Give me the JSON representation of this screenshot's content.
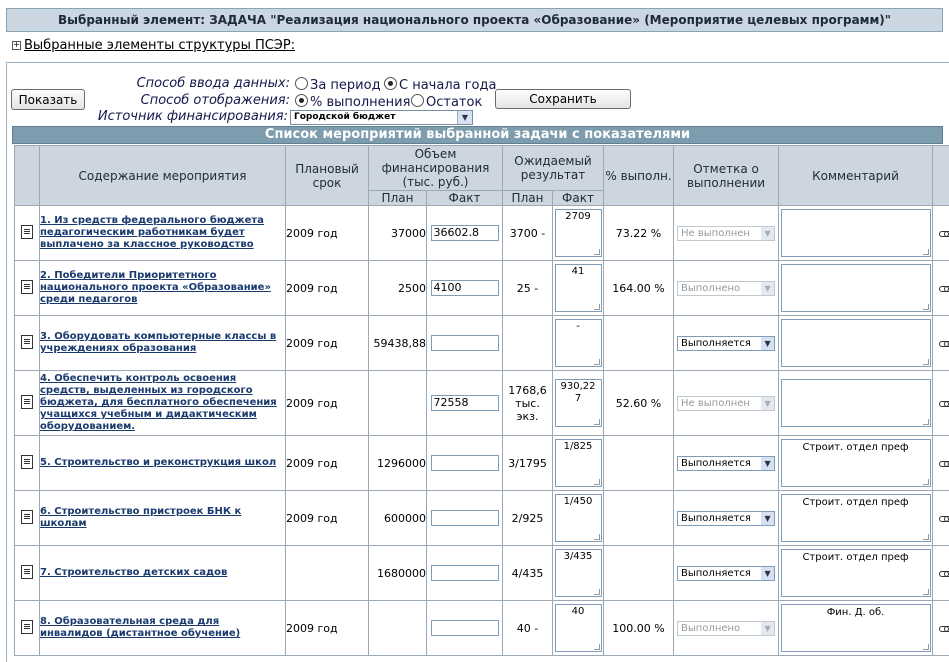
{
  "title": "Выбранный элемент: ЗАДАЧА \"Реализация национального проекта «Образование» (Мероприятие целевых программ)\"",
  "structure_toggle": "+",
  "structure_link": "Выбранные элементы структуры ПСЭР:",
  "controls": {
    "input_mode_label": "Способ ввода данных:",
    "input_mode_options": [
      "За период",
      "С начала года"
    ],
    "display_mode_label": "Способ отображения:",
    "display_mode_options": [
      "% выполнения",
      "Остаток"
    ],
    "funding_label": "Источник финансирования:",
    "funding_value": "Городской бюджет",
    "show_button": "Показать",
    "save_button": "Сохранить"
  },
  "list_title": "Список мероприятий выбранной задачи с показателями",
  "headers": {
    "content": "Содержание мероприятия",
    "term": "Плановый срок",
    "funding": "Объем финансирования (тыс. руб.)",
    "result": "Ожидаемый результат",
    "percent": "% выполн.",
    "mark": "Отметка о выполнении",
    "comment": "Комментарий",
    "plan": "План",
    "fact": "Факт"
  },
  "rows": [
    {
      "name": "1. Из средств федерального бюджета педагогическим работникам будет выплачено за классное руководство",
      "term": "2009 год",
      "fund_plan": "37000",
      "fund_fact": "36602.8",
      "res_plan": "3700 -",
      "res_fact": "2709",
      "percent": "73.22 %",
      "status": "Не выполнен",
      "comment": ""
    },
    {
      "name": "2. Победители Приоритетного национального проекта «Образование» среди педагогов",
      "term": "2009 год",
      "fund_plan": "2500",
      "fund_fact": "4100",
      "res_plan": "25 -",
      "res_fact": "41",
      "percent": "164.00 %",
      "status": "Выполнено",
      "comment": ""
    },
    {
      "name": "3. Оборудовать компьютерные классы в учреждениях образования",
      "term": "2009 год",
      "fund_plan": "59438,88",
      "fund_fact": "",
      "res_plan": "",
      "res_fact": "-",
      "percent": "",
      "status": "Выполняется",
      "comment": ""
    },
    {
      "name": "4. Обеспечить контроль освоения средств, выделенных из городского бюджета, для бесплатного обеспечения учащихся учебным и дидактическим оборудованием.",
      "term": "2009 год",
      "fund_plan": "",
      "fund_fact": "72558",
      "res_plan": "1768,6 тыс. экз.",
      "res_fact": "930,227",
      "percent": "52.60 %",
      "status": "Не выполнен",
      "comment": ""
    },
    {
      "name": "5. Строительство и реконструкция школ",
      "term": "2009 год",
      "fund_plan": "1296000",
      "fund_fact": "",
      "res_plan": "3/1795",
      "res_fact": "1/825",
      "percent": "",
      "status": "Выполняется",
      "comment": "Строит. отдел преф"
    },
    {
      "name": "6. Строительство пристроек БНК к школам",
      "term": "2009 год",
      "fund_plan": "600000",
      "fund_fact": "",
      "res_plan": "2/925",
      "res_fact": "1/450",
      "percent": "",
      "status": "Выполняется",
      "comment": "Строит. отдел преф"
    },
    {
      "name": "7. Строительство детских садов",
      "term": "",
      "fund_plan": "1680000",
      "fund_fact": "",
      "res_plan": "4/435",
      "res_fact": "3/435",
      "percent": "",
      "status": "Выполняется",
      "comment": "Строит. отдел преф"
    },
    {
      "name": "8. Образовательная среда для инвалидов (дистантное обучение)",
      "term": "2009 год",
      "fund_plan": "",
      "fund_fact": "",
      "res_plan": "40 -",
      "res_fact": "40",
      "percent": "100.00 %",
      "status": "Выполнено",
      "comment": "Фин. Д. об."
    }
  ]
}
